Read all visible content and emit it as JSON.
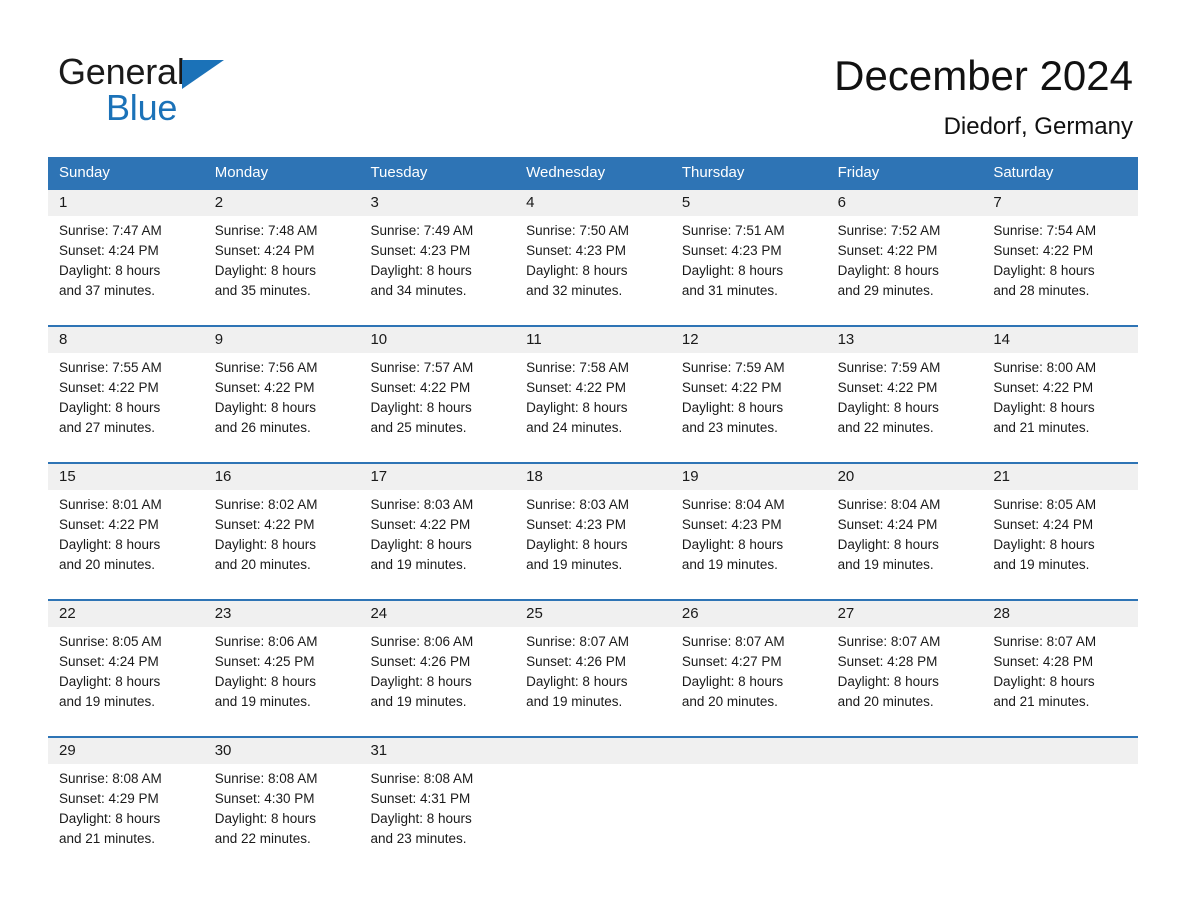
{
  "brand": {
    "logo_text_top": "General",
    "logo_text_bottom": "Blue",
    "accent_color": "#1b72b8"
  },
  "header": {
    "title": "December 2024",
    "subtitle": "Diedorf, Germany"
  },
  "theme": {
    "header_blue": "#2e74b5",
    "day_band_gray": "#f0f0f0",
    "text_color": "#1a1a1a"
  },
  "weekdays": [
    "Sunday",
    "Monday",
    "Tuesday",
    "Wednesday",
    "Thursday",
    "Friday",
    "Saturday"
  ],
  "weeks": [
    [
      {
        "day": "1",
        "sunrise": "Sunrise: 7:47 AM",
        "sunset": "Sunset: 4:24 PM",
        "daylight1": "Daylight: 8 hours",
        "daylight2": "and 37 minutes."
      },
      {
        "day": "2",
        "sunrise": "Sunrise: 7:48 AM",
        "sunset": "Sunset: 4:24 PM",
        "daylight1": "Daylight: 8 hours",
        "daylight2": "and 35 minutes."
      },
      {
        "day": "3",
        "sunrise": "Sunrise: 7:49 AM",
        "sunset": "Sunset: 4:23 PM",
        "daylight1": "Daylight: 8 hours",
        "daylight2": "and 34 minutes."
      },
      {
        "day": "4",
        "sunrise": "Sunrise: 7:50 AM",
        "sunset": "Sunset: 4:23 PM",
        "daylight1": "Daylight: 8 hours",
        "daylight2": "and 32 minutes."
      },
      {
        "day": "5",
        "sunrise": "Sunrise: 7:51 AM",
        "sunset": "Sunset: 4:23 PM",
        "daylight1": "Daylight: 8 hours",
        "daylight2": "and 31 minutes."
      },
      {
        "day": "6",
        "sunrise": "Sunrise: 7:52 AM",
        "sunset": "Sunset: 4:22 PM",
        "daylight1": "Daylight: 8 hours",
        "daylight2": "and 29 minutes."
      },
      {
        "day": "7",
        "sunrise": "Sunrise: 7:54 AM",
        "sunset": "Sunset: 4:22 PM",
        "daylight1": "Daylight: 8 hours",
        "daylight2": "and 28 minutes."
      }
    ],
    [
      {
        "day": "8",
        "sunrise": "Sunrise: 7:55 AM",
        "sunset": "Sunset: 4:22 PM",
        "daylight1": "Daylight: 8 hours",
        "daylight2": "and 27 minutes."
      },
      {
        "day": "9",
        "sunrise": "Sunrise: 7:56 AM",
        "sunset": "Sunset: 4:22 PM",
        "daylight1": "Daylight: 8 hours",
        "daylight2": "and 26 minutes."
      },
      {
        "day": "10",
        "sunrise": "Sunrise: 7:57 AM",
        "sunset": "Sunset: 4:22 PM",
        "daylight1": "Daylight: 8 hours",
        "daylight2": "and 25 minutes."
      },
      {
        "day": "11",
        "sunrise": "Sunrise: 7:58 AM",
        "sunset": "Sunset: 4:22 PM",
        "daylight1": "Daylight: 8 hours",
        "daylight2": "and 24 minutes."
      },
      {
        "day": "12",
        "sunrise": "Sunrise: 7:59 AM",
        "sunset": "Sunset: 4:22 PM",
        "daylight1": "Daylight: 8 hours",
        "daylight2": "and 23 minutes."
      },
      {
        "day": "13",
        "sunrise": "Sunrise: 7:59 AM",
        "sunset": "Sunset: 4:22 PM",
        "daylight1": "Daylight: 8 hours",
        "daylight2": "and 22 minutes."
      },
      {
        "day": "14",
        "sunrise": "Sunrise: 8:00 AM",
        "sunset": "Sunset: 4:22 PM",
        "daylight1": "Daylight: 8 hours",
        "daylight2": "and 21 minutes."
      }
    ],
    [
      {
        "day": "15",
        "sunrise": "Sunrise: 8:01 AM",
        "sunset": "Sunset: 4:22 PM",
        "daylight1": "Daylight: 8 hours",
        "daylight2": "and 20 minutes."
      },
      {
        "day": "16",
        "sunrise": "Sunrise: 8:02 AM",
        "sunset": "Sunset: 4:22 PM",
        "daylight1": "Daylight: 8 hours",
        "daylight2": "and 20 minutes."
      },
      {
        "day": "17",
        "sunrise": "Sunrise: 8:03 AM",
        "sunset": "Sunset: 4:22 PM",
        "daylight1": "Daylight: 8 hours",
        "daylight2": "and 19 minutes."
      },
      {
        "day": "18",
        "sunrise": "Sunrise: 8:03 AM",
        "sunset": "Sunset: 4:23 PM",
        "daylight1": "Daylight: 8 hours",
        "daylight2": "and 19 minutes."
      },
      {
        "day": "19",
        "sunrise": "Sunrise: 8:04 AM",
        "sunset": "Sunset: 4:23 PM",
        "daylight1": "Daylight: 8 hours",
        "daylight2": "and 19 minutes."
      },
      {
        "day": "20",
        "sunrise": "Sunrise: 8:04 AM",
        "sunset": "Sunset: 4:24 PM",
        "daylight1": "Daylight: 8 hours",
        "daylight2": "and 19 minutes."
      },
      {
        "day": "21",
        "sunrise": "Sunrise: 8:05 AM",
        "sunset": "Sunset: 4:24 PM",
        "daylight1": "Daylight: 8 hours",
        "daylight2": "and 19 minutes."
      }
    ],
    [
      {
        "day": "22",
        "sunrise": "Sunrise: 8:05 AM",
        "sunset": "Sunset: 4:24 PM",
        "daylight1": "Daylight: 8 hours",
        "daylight2": "and 19 minutes."
      },
      {
        "day": "23",
        "sunrise": "Sunrise: 8:06 AM",
        "sunset": "Sunset: 4:25 PM",
        "daylight1": "Daylight: 8 hours",
        "daylight2": "and 19 minutes."
      },
      {
        "day": "24",
        "sunrise": "Sunrise: 8:06 AM",
        "sunset": "Sunset: 4:26 PM",
        "daylight1": "Daylight: 8 hours",
        "daylight2": "and 19 minutes."
      },
      {
        "day": "25",
        "sunrise": "Sunrise: 8:07 AM",
        "sunset": "Sunset: 4:26 PM",
        "daylight1": "Daylight: 8 hours",
        "daylight2": "and 19 minutes."
      },
      {
        "day": "26",
        "sunrise": "Sunrise: 8:07 AM",
        "sunset": "Sunset: 4:27 PM",
        "daylight1": "Daylight: 8 hours",
        "daylight2": "and 20 minutes."
      },
      {
        "day": "27",
        "sunrise": "Sunrise: 8:07 AM",
        "sunset": "Sunset: 4:28 PM",
        "daylight1": "Daylight: 8 hours",
        "daylight2": "and 20 minutes."
      },
      {
        "day": "28",
        "sunrise": "Sunrise: 8:07 AM",
        "sunset": "Sunset: 4:28 PM",
        "daylight1": "Daylight: 8 hours",
        "daylight2": "and 21 minutes."
      }
    ],
    [
      {
        "day": "29",
        "sunrise": "Sunrise: 8:08 AM",
        "sunset": "Sunset: 4:29 PM",
        "daylight1": "Daylight: 8 hours",
        "daylight2": "and 21 minutes."
      },
      {
        "day": "30",
        "sunrise": "Sunrise: 8:08 AM",
        "sunset": "Sunset: 4:30 PM",
        "daylight1": "Daylight: 8 hours",
        "daylight2": "and 22 minutes."
      },
      {
        "day": "31",
        "sunrise": "Sunrise: 8:08 AM",
        "sunset": "Sunset: 4:31 PM",
        "daylight1": "Daylight: 8 hours",
        "daylight2": "and 23 minutes."
      },
      {
        "day": "",
        "sunrise": "",
        "sunset": "",
        "daylight1": "",
        "daylight2": ""
      },
      {
        "day": "",
        "sunrise": "",
        "sunset": "",
        "daylight1": "",
        "daylight2": ""
      },
      {
        "day": "",
        "sunrise": "",
        "sunset": "",
        "daylight1": "",
        "daylight2": ""
      },
      {
        "day": "",
        "sunrise": "",
        "sunset": "",
        "daylight1": "",
        "daylight2": ""
      }
    ]
  ]
}
